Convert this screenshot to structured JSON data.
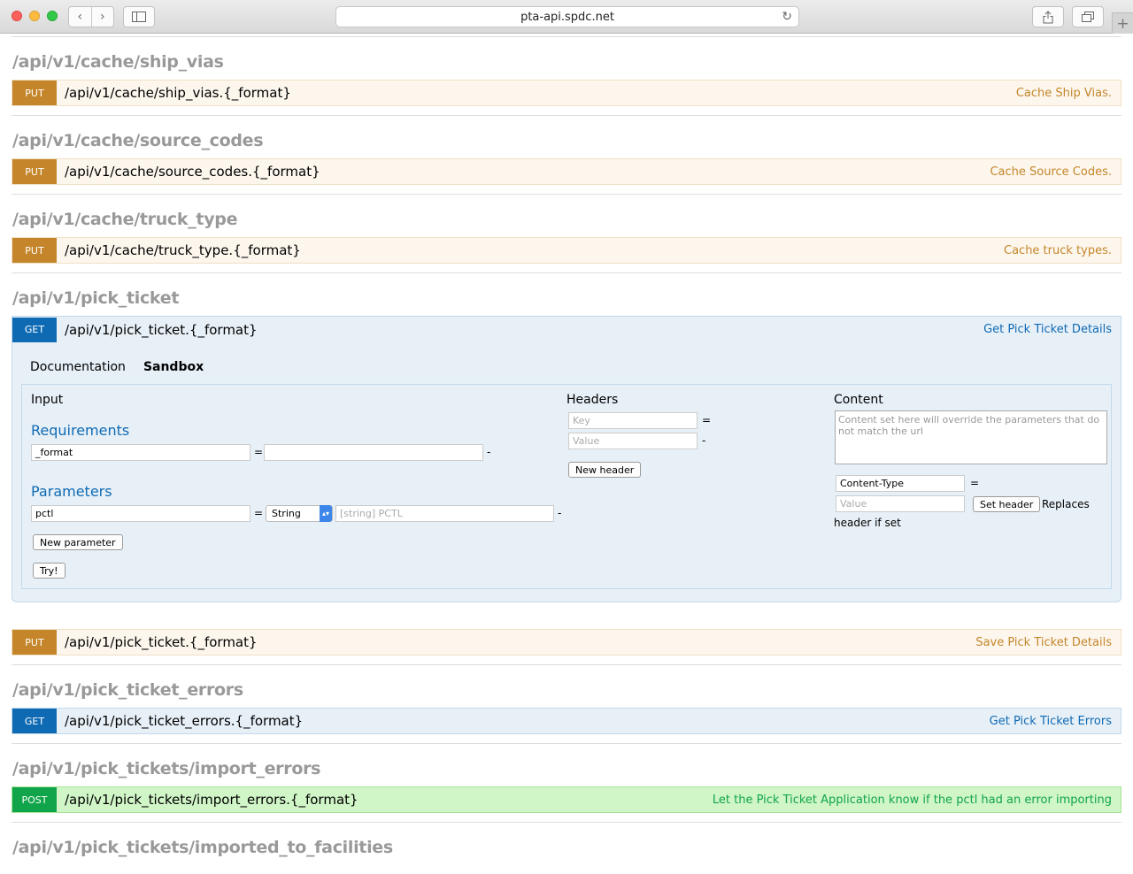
{
  "browser": {
    "url": "pta-api.spdc.net"
  },
  "resources": [
    {
      "title": "/api/v1/cache/ship_vias",
      "ops": [
        {
          "verb": "PUT",
          "path": "/api/v1/cache/ship_vias.{_format}",
          "summary": "Cache Ship Vias."
        }
      ]
    },
    {
      "title": "/api/v1/cache/source_codes",
      "ops": [
        {
          "verb": "PUT",
          "path": "/api/v1/cache/source_codes.{_format}",
          "summary": "Cache Source Codes."
        }
      ]
    },
    {
      "title": "/api/v1/cache/truck_type",
      "ops": [
        {
          "verb": "PUT",
          "path": "/api/v1/cache/truck_type.{_format}",
          "summary": "Cache truck types."
        }
      ]
    },
    {
      "title": "/api/v1/pick_ticket",
      "ops": [
        {
          "verb": "GET",
          "path": "/api/v1/pick_ticket.{_format}",
          "summary": "Get Pick Ticket Details"
        },
        {
          "verb": "PUT",
          "path": "/api/v1/pick_ticket.{_format}",
          "summary": "Save Pick Ticket Details"
        }
      ]
    },
    {
      "title": "/api/v1/pick_ticket_errors",
      "ops": [
        {
          "verb": "GET",
          "path": "/api/v1/pick_ticket_errors.{_format}",
          "summary": "Get Pick Ticket Errors"
        }
      ]
    },
    {
      "title": "/api/v1/pick_tickets/import_errors",
      "ops": [
        {
          "verb": "POST",
          "path": "/api/v1/pick_tickets/import_errors.{_format}",
          "summary": "Let the Pick Ticket Application know if the pctl had an error importing"
        }
      ]
    },
    {
      "title": "/api/v1/pick_tickets/imported_to_facilities",
      "ops": []
    }
  ],
  "sandbox": {
    "tabs": {
      "documentation": "Documentation",
      "sandbox": "Sandbox"
    },
    "input_title": "Input",
    "requirements_title": "Requirements",
    "requirement": {
      "name": "_format",
      "value": "",
      "eq": "=",
      "dash": "-"
    },
    "parameters_title": "Parameters",
    "parameter": {
      "name": "pctl",
      "type": "String",
      "placeholder": "[string] PCTL",
      "eq": "=",
      "dash": "-"
    },
    "new_parameter_label": "New parameter",
    "try_label": "Try!",
    "headers_title": "Headers",
    "header_key_placeholder": "Key",
    "header_value_placeholder": "Value",
    "header_eq": "=",
    "header_dash": "-",
    "new_header_label": "New header",
    "content_title": "Content",
    "content_placeholder": "Content set here will override the parameters that do not match the url",
    "content_type_label": "Content-Type",
    "content_type_eq": "=",
    "content_value_placeholder": "Value",
    "set_header_label": "Set header",
    "replaces_text": "Replaces",
    "header_if_set_text": "header if set"
  }
}
